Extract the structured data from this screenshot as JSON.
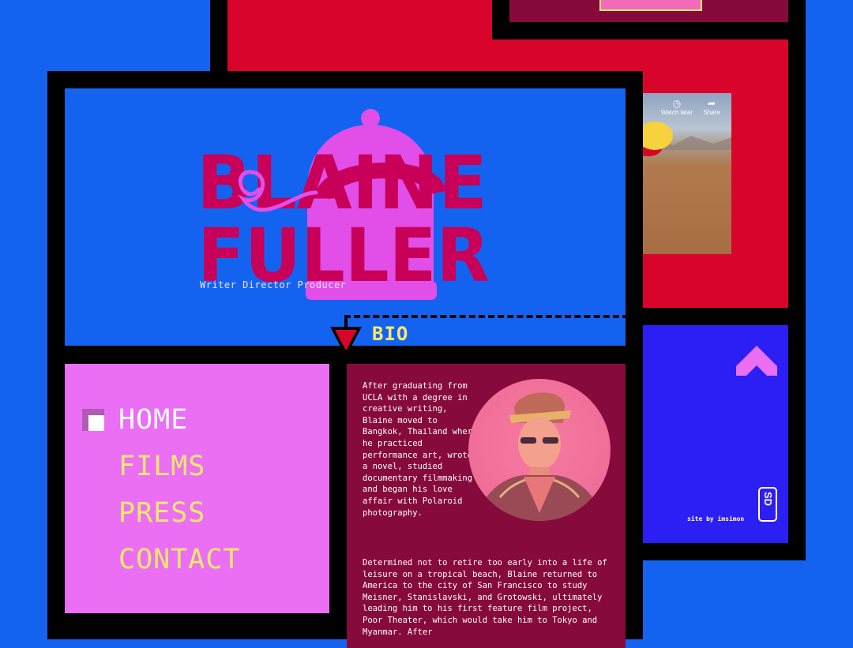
{
  "hero": {
    "logo_text": [
      "BLAINE",
      "FULLER"
    ],
    "subtitle": "Writer Director Producer"
  },
  "bio_link": {
    "label": "BIO"
  },
  "nav": {
    "items": [
      {
        "label": "HOME",
        "active": true
      },
      {
        "label": "FILMS",
        "active": false
      },
      {
        "label": "PRESS",
        "active": false
      },
      {
        "label": "CONTACT",
        "active": false
      }
    ]
  },
  "bio": {
    "paragraph1": "After graduating from UCLA with a degree in creative writing, Blaine moved to Bangkok, Thailand where he practiced performance art, wrote a novel, studied documentary filmmaking and began his love affair with Polaroid photography.",
    "paragraph2": "Determined not to retire too early into a life of leisure on a tropical beach, Blaine returned to America to the city of San Francisco to study Meisner, Stanislavski, and Grotowski, ultimately leading him to his first feature film project, Poor Theater, which would take him to Tokyo and Myanmar. After"
  },
  "video": {
    "watch_later": "Watch later",
    "share": "Share"
  },
  "footer": {
    "credit": "site by imsimon",
    "badge": "SD"
  },
  "colors": {
    "background": "#1463f0",
    "red": "#d90429",
    "maroon": "#860a3b",
    "pink": "#eb6ff4",
    "yellow": "#f6e96b",
    "logo": "#c8005a",
    "violet": "#2c1ff3"
  }
}
